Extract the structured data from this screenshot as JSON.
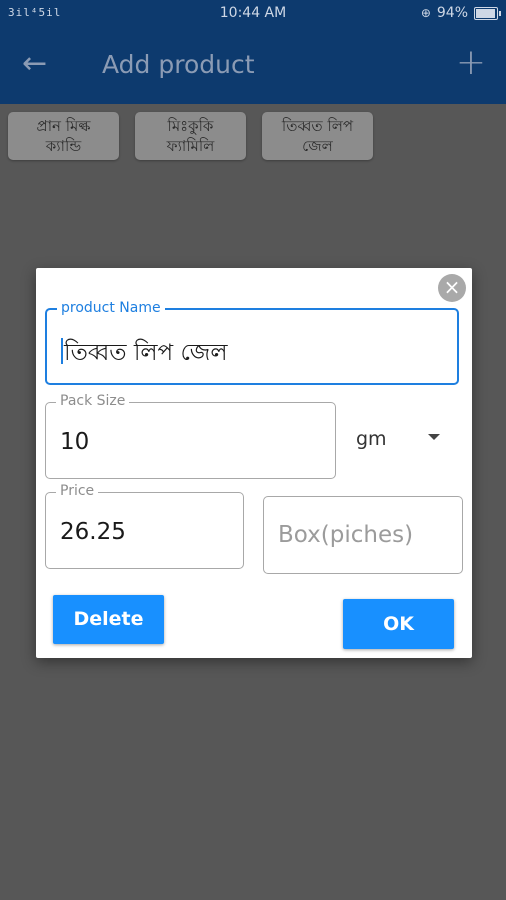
{
  "status_bar": {
    "signal": "3il⁴5il",
    "time": "10:44 AM",
    "battery_text": "94%"
  },
  "app_bar": {
    "back_icon": "←",
    "title": "Add product",
    "add_icon": "+"
  },
  "chips": [
    {
      "line1": "প্রান মিল্ক",
      "line2": "ক্যান্ডি"
    },
    {
      "line1": "মিঃকুকি",
      "line2": "ফ্যামিলি"
    },
    {
      "line1": "তিব্বত লিপ",
      "line2": "জেল"
    }
  ],
  "dialog": {
    "close_icon": "×",
    "product_name": {
      "label": "product Name",
      "value": "তিব্বত লিপ জেল"
    },
    "pack_size": {
      "label": "Pack Size",
      "value": "10"
    },
    "unit": {
      "selected": "gm"
    },
    "price": {
      "label": "Price",
      "value": "26.25"
    },
    "box": {
      "placeholder": "Box(piches)"
    },
    "delete_label": "Delete",
    "ok_label": "OK"
  },
  "colors": {
    "app_bar": "#0d3a6e",
    "accent": "#1890ff",
    "focus_border": "#1e7fe0",
    "overlay": "#575757"
  }
}
